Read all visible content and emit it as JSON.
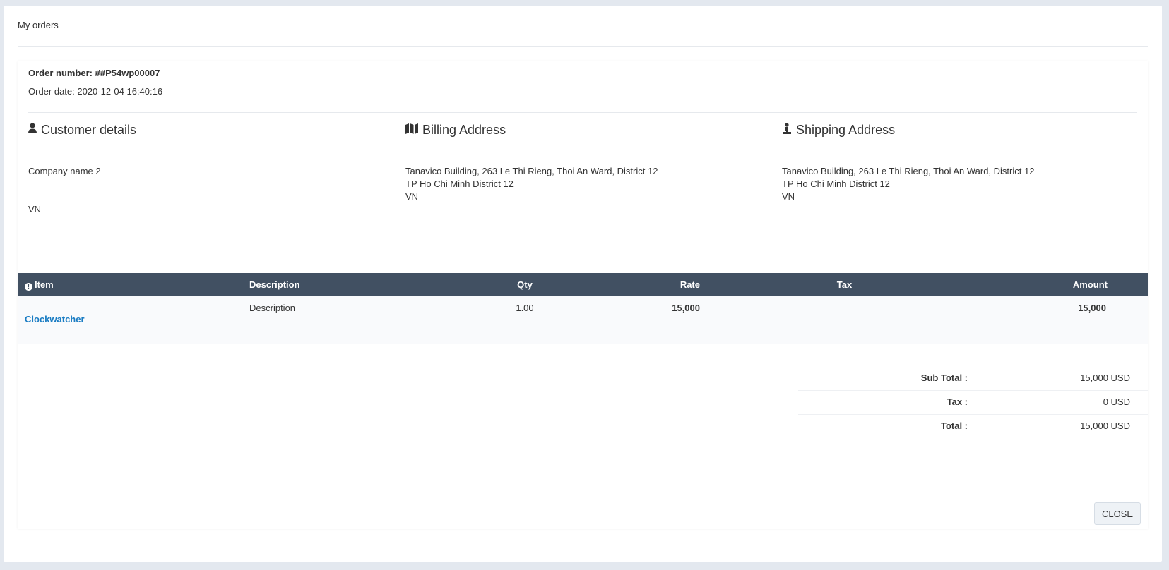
{
  "page": {
    "title": "My orders"
  },
  "order": {
    "number_label": "Order number: ##P54wp00007",
    "date_label": "Order date: 2020-12-04 16:40:16"
  },
  "customer": {
    "heading": "Customer details",
    "lines": [
      "Company name 2",
      "",
      "",
      "VN"
    ]
  },
  "billing": {
    "heading": "Billing Address",
    "lines": [
      "Tanavico Building, 263 Le Thi Rieng, Thoi An Ward, District 12",
      "TP Ho Chi Minh District 12",
      "VN"
    ]
  },
  "shipping": {
    "heading": "Shipping Address",
    "lines": [
      "Tanavico Building, 263 Le Thi Rieng, Thoi An Ward, District 12",
      "TP Ho Chi Minh District 12",
      "VN"
    ]
  },
  "table": {
    "headers": {
      "item": "Item",
      "description": "Description",
      "qty": "Qty",
      "rate": "Rate",
      "tax": "Tax",
      "amount": "Amount"
    },
    "rows": [
      {
        "item": "Clockwatcher",
        "description": "Description",
        "qty": "1.00",
        "rate": "15,000",
        "tax": "",
        "amount": "15,000"
      }
    ]
  },
  "totals": {
    "subtotal_label": "Sub Total :",
    "subtotal_value": "15,000 USD",
    "tax_label": "Tax :",
    "tax_value": "0 USD",
    "total_label": "Total :",
    "total_value": "15,000 USD"
  },
  "footer": {
    "close_label": "CLOSE"
  },
  "icons": {
    "customer": "user-icon",
    "billing": "map-icon",
    "shipping": "shipping-person-icon",
    "item": "info-icon"
  },
  "colors": {
    "table_header": "#415062",
    "link": "#1a7cc3"
  }
}
